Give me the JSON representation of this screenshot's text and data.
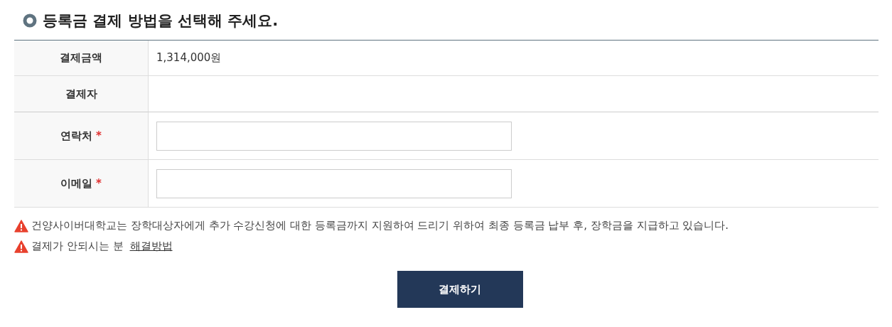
{
  "heading": {
    "title": "등록금 결제 방법을 선택해 주세요."
  },
  "rows": [
    {
      "label": "결제금액",
      "kind": "text",
      "value": "1,314,000원"
    },
    {
      "label": "결제자",
      "kind": "empty"
    },
    {
      "label": "연락처",
      "kind": "input",
      "required_mark": "*"
    },
    {
      "label": "이메일",
      "kind": "input",
      "required_mark": "*"
    }
  ],
  "notices": [
    {
      "text": "건양사이버대학교는 장학대상자에게 추가 수강신청에 대한 등록금까지 지원하여 드리기 위하여 최종 등록금 납부 후, 장학금을 지급하고 있습니다."
    },
    {
      "text": "결제가 안되시는 분",
      "link": "해결방법"
    }
  ],
  "submit_button": "결제하기"
}
